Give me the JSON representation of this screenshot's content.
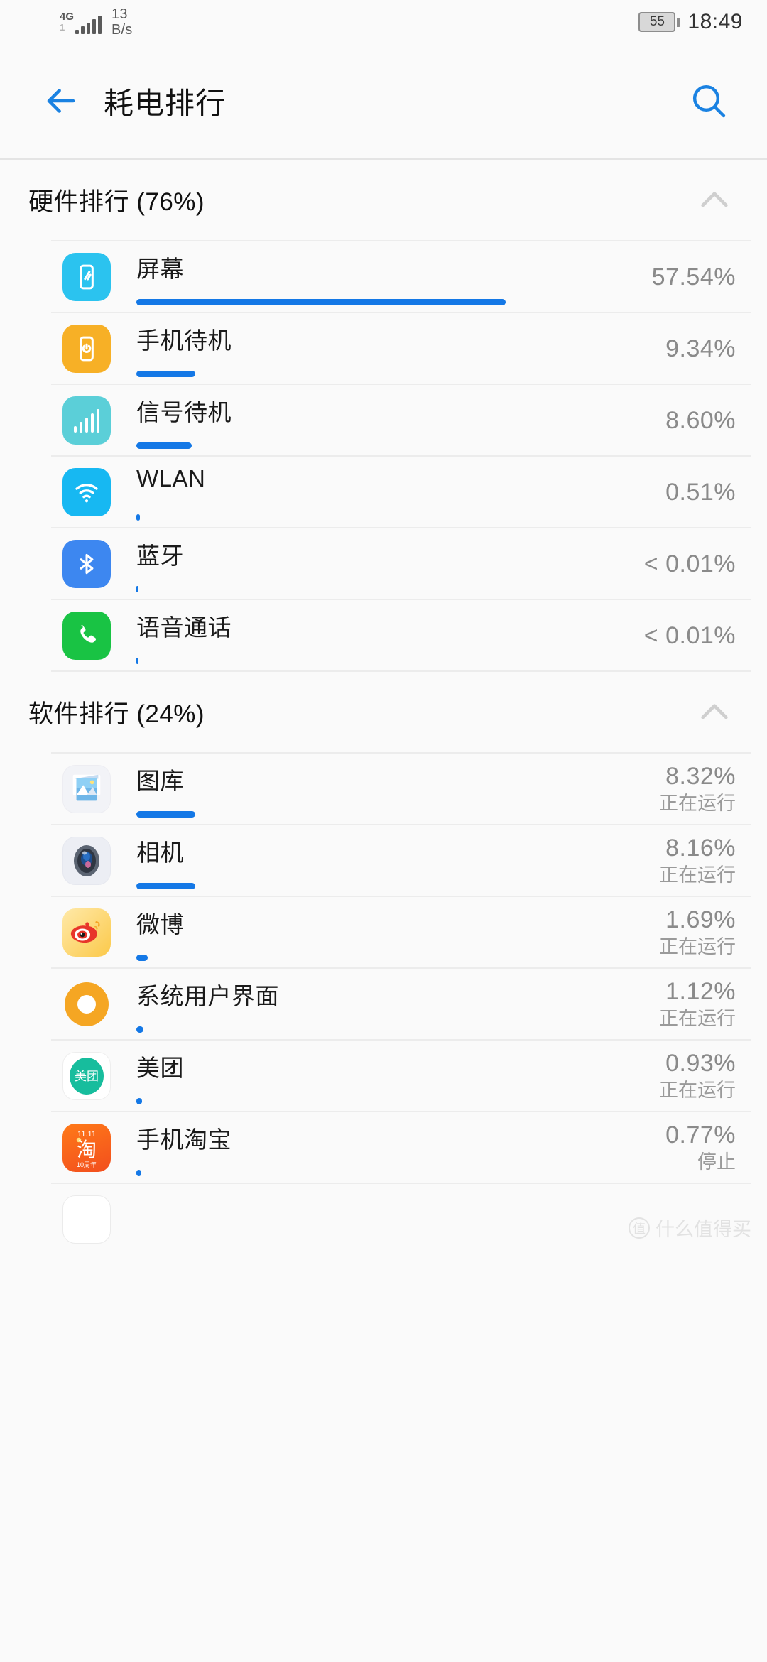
{
  "status_bar": {
    "network_type": "4G",
    "network_sub": "1",
    "speed_value": "13",
    "speed_unit": "B/s",
    "battery_level": "55",
    "time": "18:49"
  },
  "toolbar": {
    "back_icon": "arrow-left-icon",
    "title": "耗电排行",
    "search_icon": "search-icon",
    "accent_color": "#1a82e2"
  },
  "sections": [
    {
      "id": "hardware",
      "title": "硬件排行 (76%)",
      "collapse_icon": "chevron-up-icon",
      "items": [
        {
          "name": "屏幕",
          "percent": "57.54%",
          "bar": 100,
          "icon": "screen-icon",
          "icon_color": "#2bc3ef"
        },
        {
          "name": "手机待机",
          "percent": "9.34%",
          "bar": 16,
          "icon": "power-icon",
          "icon_color": "#f7b026"
        },
        {
          "name": "信号待机",
          "percent": "8.60%",
          "bar": 15,
          "icon": "signal-icon",
          "icon_color": "#5bcfd8"
        },
        {
          "name": "WLAN",
          "percent": "0.51%",
          "bar": 1,
          "icon": "wifi-icon",
          "icon_color": "#17b8f2"
        },
        {
          "name": "蓝牙",
          "percent": "< 0.01%",
          "bar": 0.6,
          "icon": "bluetooth-icon",
          "icon_color": "#3d87f0"
        },
        {
          "name": "语音通话",
          "percent": "< 0.01%",
          "bar": 0.6,
          "icon": "phone-icon",
          "icon_color": "#19c344"
        }
      ]
    },
    {
      "id": "software",
      "title": "软件排行 (24%)",
      "collapse_icon": "chevron-up-icon",
      "items": [
        {
          "name": "图库",
          "percent": "8.32%",
          "state": "正在运行",
          "bar": 16,
          "icon": "gallery-app-icon"
        },
        {
          "name": "相机",
          "percent": "8.16%",
          "state": "正在运行",
          "bar": 16,
          "icon": "camera-app-icon"
        },
        {
          "name": "微博",
          "percent": "1.69%",
          "state": "正在运行",
          "bar": 3,
          "icon": "weibo-app-icon"
        },
        {
          "name": "系统用户界面",
          "percent": "1.12%",
          "state": "正在运行",
          "bar": 2,
          "icon": "system-ui-app-icon"
        },
        {
          "name": "美团",
          "percent": "0.93%",
          "state": "正在运行",
          "bar": 1.6,
          "icon": "meituan-app-icon"
        },
        {
          "name": "手机淘宝",
          "percent": "0.77%",
          "state": "停止",
          "bar": 1.4,
          "icon": "taobao-app-icon"
        }
      ]
    }
  ],
  "watermark": {
    "mark": "值",
    "text": "什么值得买"
  }
}
